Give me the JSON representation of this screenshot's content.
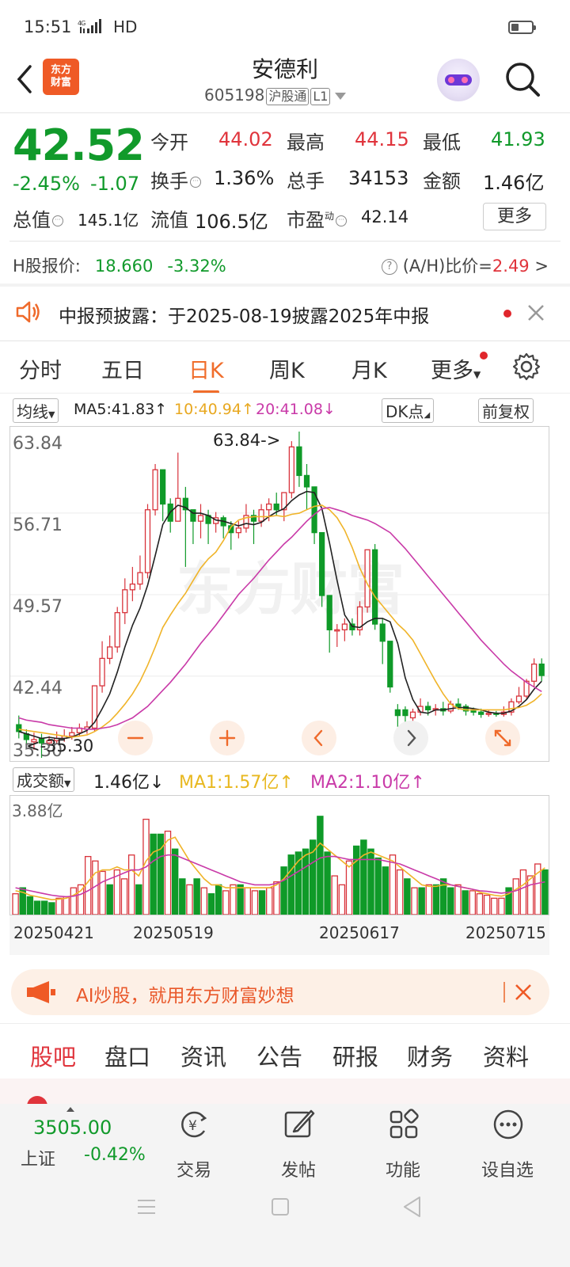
{
  "status_bar": {
    "time": "15:51",
    "signal": "⁴ᴳ",
    "hd": "HD"
  },
  "header": {
    "title": "安德利",
    "code": "605198",
    "market_tag": "沪股通",
    "level_tag": "L1",
    "logo_line1": "东方",
    "logo_line2": "财富"
  },
  "quote": {
    "price": "42.52",
    "change_pct": "-2.45%",
    "change": "-1.07",
    "rows": [
      [
        {
          "label": "今开",
          "value": "44.02",
          "color": "red"
        },
        {
          "label": "最高",
          "value": "44.15",
          "color": "red"
        },
        {
          "label": "最低",
          "value": "41.93",
          "color": "green"
        }
      ],
      [
        {
          "label": "换手",
          "value": "1.36%",
          "color": "dark"
        },
        {
          "label": "总手",
          "value": "34153",
          "color": "dark"
        },
        {
          "label": "金额",
          "value": "1.46亿",
          "color": "dark"
        }
      ],
      [
        {
          "label": "总值",
          "value": "145.1亿",
          "color": "dark"
        },
        {
          "label": "流值",
          "value": "106.5亿",
          "color": "dark"
        },
        {
          "label": "市盈",
          "value": "42.14",
          "color": "dark"
        }
      ]
    ],
    "pe_sup": "动",
    "more_label": "更多",
    "h_label": "H股报价:",
    "h_price": "18.660",
    "h_change": "-3.32%",
    "ah_label": "(A/H)比价=",
    "ah_value": "2.49"
  },
  "notice": {
    "text": "中报预披露：于2025-08-19披露2025年中报"
  },
  "kline_tabs": [
    {
      "label": "分时",
      "active": false
    },
    {
      "label": "五日",
      "active": false
    },
    {
      "label": "日K",
      "active": true
    },
    {
      "label": "周K",
      "active": false
    },
    {
      "label": "月K",
      "active": false
    },
    {
      "label": "更多",
      "active": false
    }
  ],
  "ma_bar": {
    "selector": "均线",
    "ma5": "MA5:41.83",
    "ma10": "10:40.94",
    "ma20": "20:41.08",
    "dk": "DK点",
    "adjust": "前复权"
  },
  "volume_bar": {
    "selector": "成交额",
    "value": "1.46亿",
    "ma1": "MA1:1.57亿",
    "ma2": "MA2:1.10亿",
    "max_label": "3.88亿"
  },
  "chart_data": {
    "type": "candlestick",
    "y_ticks": [
      "63.84",
      "56.71",
      "49.57",
      "42.44",
      "35.30"
    ],
    "ylim": [
      35.3,
      63.84
    ],
    "high_label": "63.84->",
    "low_label": "<-35.30",
    "x_ticks": [
      "20250421",
      "20250519",
      "20250617",
      "20250715"
    ],
    "candles": [
      [
        38.2,
        37.6,
        39.0,
        37.0
      ],
      [
        37.4,
        36.9,
        37.8,
        36.4
      ],
      [
        36.7,
        36.9,
        37.5,
        36.0
      ],
      [
        37.0,
        36.6,
        37.4,
        35.3
      ],
      [
        36.6,
        36.8,
        37.2,
        36.3
      ],
      [
        36.8,
        37.0,
        37.6,
        36.5
      ],
      [
        37.0,
        37.2,
        37.8,
        36.7
      ],
      [
        37.2,
        37.5,
        38.0,
        36.9
      ],
      [
        37.5,
        37.9,
        38.3,
        37.2
      ],
      [
        37.8,
        38.0,
        38.5,
        37.4
      ],
      [
        37.9,
        41.6,
        41.6,
        37.6
      ],
      [
        41.6,
        44.0,
        45.5,
        41.0
      ],
      [
        44.0,
        45.0,
        46.0,
        43.5
      ],
      [
        45.0,
        48.0,
        48.5,
        44.5
      ],
      [
        48.0,
        50.0,
        51.0,
        47.0
      ],
      [
        50.0,
        50.5,
        52.0,
        49.0
      ],
      [
        50.5,
        51.5,
        53.0,
        50.0
      ],
      [
        51.5,
        57.0,
        57.5,
        51.0
      ],
      [
        57.0,
        60.5,
        61.0,
        56.5
      ],
      [
        60.5,
        57.5,
        60.5,
        56.0
      ],
      [
        57.5,
        56.0,
        58.0,
        55.0
      ],
      [
        56.0,
        58.0,
        62.0,
        56.0
      ],
      [
        58.0,
        57.0,
        59.0,
        52.0
      ],
      [
        57.0,
        56.0,
        57.0,
        54.0
      ],
      [
        56.0,
        56.5,
        57.5,
        54.5
      ],
      [
        56.5,
        55.8,
        57.0,
        54.0
      ],
      [
        55.8,
        56.3,
        56.8,
        55.0
      ],
      [
        56.3,
        55.6,
        56.5,
        54.5
      ],
      [
        55.6,
        55.0,
        56.0,
        53.5
      ],
      [
        55.0,
        55.4,
        56.0,
        54.5
      ],
      [
        55.4,
        56.5,
        57.5,
        55.0
      ],
      [
        56.5,
        56.0,
        57.0,
        54.0
      ],
      [
        56.0,
        57.0,
        57.5,
        55.5
      ],
      [
        57.0,
        57.5,
        58.0,
        56.0
      ],
      [
        57.5,
        57.0,
        58.5,
        56.5
      ],
      [
        57.0,
        58.5,
        58.5,
        56.0
      ],
      [
        58.5,
        62.5,
        63.0,
        58.0
      ],
      [
        62.5,
        60.0,
        63.84,
        59.0
      ],
      [
        60.0,
        59.0,
        61.0,
        57.0
      ],
      [
        59.0,
        55.0,
        59.0,
        54.0
      ],
      [
        55.0,
        49.5,
        55.0,
        48.5
      ],
      [
        49.5,
        46.5,
        49.5,
        44.5
      ],
      [
        46.5,
        46.5,
        47.0,
        45.0
      ],
      [
        46.5,
        47.0,
        47.5,
        45.5
      ],
      [
        47.0,
        46.5,
        47.5,
        46.0
      ],
      [
        46.5,
        48.5,
        49.0,
        46.0
      ],
      [
        48.5,
        53.5,
        53.5,
        48.0
      ],
      [
        53.5,
        47.0,
        54.0,
        46.5
      ],
      [
        47.0,
        45.5,
        47.5,
        43.5
      ],
      [
        45.5,
        41.5,
        45.5,
        41.0
      ],
      [
        39.5,
        39.0,
        40.0,
        38.0
      ],
      [
        39.5,
        39.0,
        39.8,
        38.0
      ],
      [
        38.8,
        39.3,
        39.6,
        38.5
      ],
      [
        39.3,
        39.8,
        40.5,
        39.0
      ],
      [
        39.8,
        39.5,
        40.2,
        39.0
      ],
      [
        39.5,
        39.6,
        40.0,
        39.0
      ],
      [
        39.6,
        39.4,
        40.2,
        39.0
      ],
      [
        39.4,
        40.0,
        40.3,
        39.2
      ],
      [
        40.0,
        39.8,
        40.5,
        39.5
      ],
      [
        39.8,
        39.4,
        40.0,
        39.0
      ],
      [
        39.4,
        39.3,
        39.7,
        39.0
      ],
      [
        39.3,
        39.1,
        39.6,
        38.8
      ],
      [
        39.1,
        39.2,
        39.5,
        38.9
      ],
      [
        39.2,
        39.1,
        39.4,
        38.9
      ],
      [
        39.1,
        39.3,
        39.8,
        38.9
      ],
      [
        39.3,
        40.2,
        40.5,
        39.0
      ],
      [
        40.2,
        40.7,
        41.5,
        40.0
      ],
      [
        40.7,
        42.0,
        42.2,
        40.5
      ],
      [
        42.0,
        43.5,
        44.0,
        41.5
      ],
      [
        43.5,
        42.5,
        44.0,
        42.0
      ]
    ],
    "ma5": [
      37.6,
      37.4,
      37.2,
      37.0,
      37.1,
      37.0,
      37.0,
      37.1,
      37.4,
      37.7,
      38.4,
      39.6,
      40.9,
      42.8,
      45.0,
      46.9,
      48.4,
      50.4,
      53.0,
      55.7,
      56.8,
      57.4,
      57.2,
      56.7,
      56.7,
      56.5,
      56.1,
      56.0,
      55.8,
      55.6,
      55.8,
      55.7,
      55.9,
      56.4,
      56.8,
      57.1,
      57.8,
      58.3,
      58.6,
      58.5,
      57.1,
      54.1,
      50.8,
      47.8,
      46.8,
      46.7,
      47.2,
      47.5,
      47.5,
      47.2,
      45.3,
      42.3,
      40.4,
      39.3,
      39.2,
      39.5,
      39.5,
      39.6,
      39.7,
      39.7,
      39.6,
      39.5,
      39.3,
      39.2,
      39.2,
      39.4,
      39.8,
      40.4,
      41.3,
      42.0
    ],
    "ma10": [
      37.8,
      37.7,
      37.6,
      37.5,
      37.4,
      37.3,
      37.2,
      37.1,
      37.2,
      37.3,
      37.6,
      38.0,
      38.5,
      39.2,
      40.0,
      40.9,
      42.0,
      43.4,
      45.0,
      46.7,
      47.8,
      48.8,
      49.7,
      50.8,
      51.9,
      52.7,
      53.3,
      54.3,
      55.5,
      56.1,
      56.3,
      56.4,
      56.4,
      56.4,
      56.5,
      56.4,
      56.6,
      56.7,
      57.0,
      57.3,
      57.4,
      57.0,
      56.3,
      55.2,
      53.7,
      51.9,
      50.5,
      49.4,
      48.6,
      47.8,
      47.0,
      46.4,
      45.6,
      44.4,
      43.2,
      42.0,
      40.9,
      40.0,
      39.6,
      39.5,
      39.5,
      39.5,
      39.5,
      39.5,
      39.5,
      39.6,
      39.7,
      39.9,
      40.3,
      40.9
    ],
    "ma20": [
      38.8,
      38.6,
      38.5,
      38.4,
      38.2,
      38.1,
      38.0,
      37.9,
      37.9,
      37.8,
      37.8,
      37.9,
      38.0,
      38.2,
      38.5,
      38.8,
      39.3,
      39.8,
      40.5,
      41.2,
      41.9,
      42.7,
      43.5,
      44.4,
      45.3,
      46.1,
      46.9,
      47.8,
      48.7,
      49.6,
      50.3,
      51.0,
      51.8,
      52.6,
      53.3,
      54.0,
      54.6,
      55.3,
      56.0,
      56.6,
      57.1,
      57.2,
      57.0,
      56.8,
      56.5,
      56.3,
      56.1,
      55.8,
      55.4,
      55.0,
      54.3,
      53.6,
      52.8,
      52.0,
      51.2,
      50.4,
      49.6,
      48.8,
      48.0,
      47.2,
      46.4,
      45.6,
      44.9,
      44.2,
      43.5,
      42.9,
      42.4,
      41.9,
      41.5,
      41.1
    ]
  },
  "volume_data": {
    "values": [
      0.7,
      0.9,
      0.6,
      0.45,
      0.45,
      0.4,
      0.55,
      0.6,
      0.9,
      1.0,
      1.95,
      1.8,
      1.45,
      1.0,
      1.5,
      1.2,
      2.0,
      1.0,
      3.2,
      2.7,
      2.7,
      2.8,
      2.2,
      1.2,
      1.0,
      1.2,
      0.9,
      0.7,
      1.0,
      0.8,
      1.0,
      1.0,
      0.9,
      0.8,
      0.8,
      0.9,
      1.1,
      1.6,
      2.0,
      2.1,
      2.2,
      2.5,
      3.3,
      2.1,
      1.3,
      1.0,
      1.8,
      2.3,
      2.5,
      2.2,
      1.9,
      1.6,
      2.0,
      1.5,
      1.2,
      0.9,
      0.9,
      1.0,
      1.0,
      1.2,
      0.9,
      1.0,
      0.8,
      0.8,
      0.7,
      0.65,
      0.55,
      0.55,
      0.9,
      1.2,
      1.5,
      1.3,
      1.7,
      1.5
    ],
    "rising": [
      true,
      false,
      false,
      false,
      false,
      false,
      true,
      true,
      true,
      true,
      true,
      true,
      true,
      false,
      true,
      true,
      true,
      false,
      true,
      false,
      false,
      true,
      false,
      false,
      true,
      false,
      true,
      false,
      false,
      true,
      true,
      false,
      true,
      true,
      false,
      true,
      true,
      false,
      false,
      false,
      false,
      false,
      false,
      false,
      true,
      true,
      true,
      false,
      false,
      false,
      false,
      false,
      true,
      true,
      false,
      true,
      false,
      true,
      false,
      false,
      false,
      true,
      false,
      true,
      true,
      true,
      true,
      true,
      false,
      true,
      true,
      true,
      true,
      false
    ],
    "ma1": [
      0.8,
      0.75,
      0.65,
      0.6,
      0.55,
      0.5,
      0.52,
      0.55,
      0.65,
      0.8,
      1.1,
      1.4,
      1.5,
      1.5,
      1.6,
      1.5,
      1.5,
      1.3,
      1.8,
      2.1,
      2.2,
      2.5,
      2.6,
      2.2,
      1.8,
      1.5,
      1.2,
      1.0,
      1.0,
      0.9,
      0.9,
      0.9,
      0.9,
      0.9,
      0.9,
      0.9,
      1.0,
      1.2,
      1.5,
      1.8,
      2.0,
      2.1,
      2.4,
      2.2,
      2.0,
      1.8,
      1.6,
      1.8,
      2.0,
      2.1,
      2.0,
      1.9,
      1.8,
      1.6,
      1.4,
      1.2,
      1.0,
      0.95,
      0.95,
      1.0,
      1.0,
      0.95,
      0.9,
      0.85,
      0.75,
      0.7,
      0.65,
      0.62,
      0.7,
      0.85,
      1.0,
      1.2,
      1.4,
      1.57
    ],
    "ma2": [
      0.9,
      0.85,
      0.8,
      0.75,
      0.7,
      0.65,
      0.62,
      0.6,
      0.62,
      0.68,
      0.8,
      0.95,
      1.1,
      1.2,
      1.3,
      1.4,
      1.5,
      1.5,
      1.6,
      1.8,
      1.95,
      2.0,
      2.0,
      1.9,
      1.8,
      1.7,
      1.6,
      1.5,
      1.4,
      1.3,
      1.2,
      1.1,
      1.05,
      1.0,
      1.0,
      1.0,
      1.05,
      1.15,
      1.3,
      1.45,
      1.6,
      1.75,
      1.9,
      1.95,
      1.95,
      1.9,
      1.85,
      1.85,
      1.85,
      1.85,
      1.85,
      1.8,
      1.75,
      1.7,
      1.6,
      1.5,
      1.4,
      1.3,
      1.2,
      1.1,
      1.0,
      0.95,
      0.9,
      0.85,
      0.8,
      0.78,
      0.75,
      0.72,
      0.75,
      0.8,
      0.9,
      1.0,
      1.05,
      1.1
    ],
    "max": 3.88
  },
  "ai_banner": {
    "text": "AI炒股，就用东方财富妙想"
  },
  "bottom_tabs": [
    {
      "label": "股吧",
      "active": true
    },
    {
      "label": "盘口",
      "active": false
    },
    {
      "label": "资讯",
      "active": false
    },
    {
      "label": "公告",
      "active": false
    },
    {
      "label": "研报",
      "active": false
    },
    {
      "label": "财务",
      "active": false
    },
    {
      "label": "资料",
      "active": false
    }
  ],
  "footer": {
    "index_value": "3505.00",
    "index_name": "上证",
    "index_change": "-0.42%",
    "items": [
      {
        "label": "交易",
        "icon": "trade-icon"
      },
      {
        "label": "发帖",
        "icon": "edit-icon"
      },
      {
        "label": "功能",
        "icon": "grid-icon"
      },
      {
        "label": "设自选",
        "icon": "more-icon"
      }
    ]
  },
  "colors": {
    "up": "#d8333b",
    "down": "#0f9a28",
    "accent": "#f06d2b",
    "ma5": "#222222",
    "ma10": "#f0b429",
    "ma20": "#c93aa8"
  }
}
